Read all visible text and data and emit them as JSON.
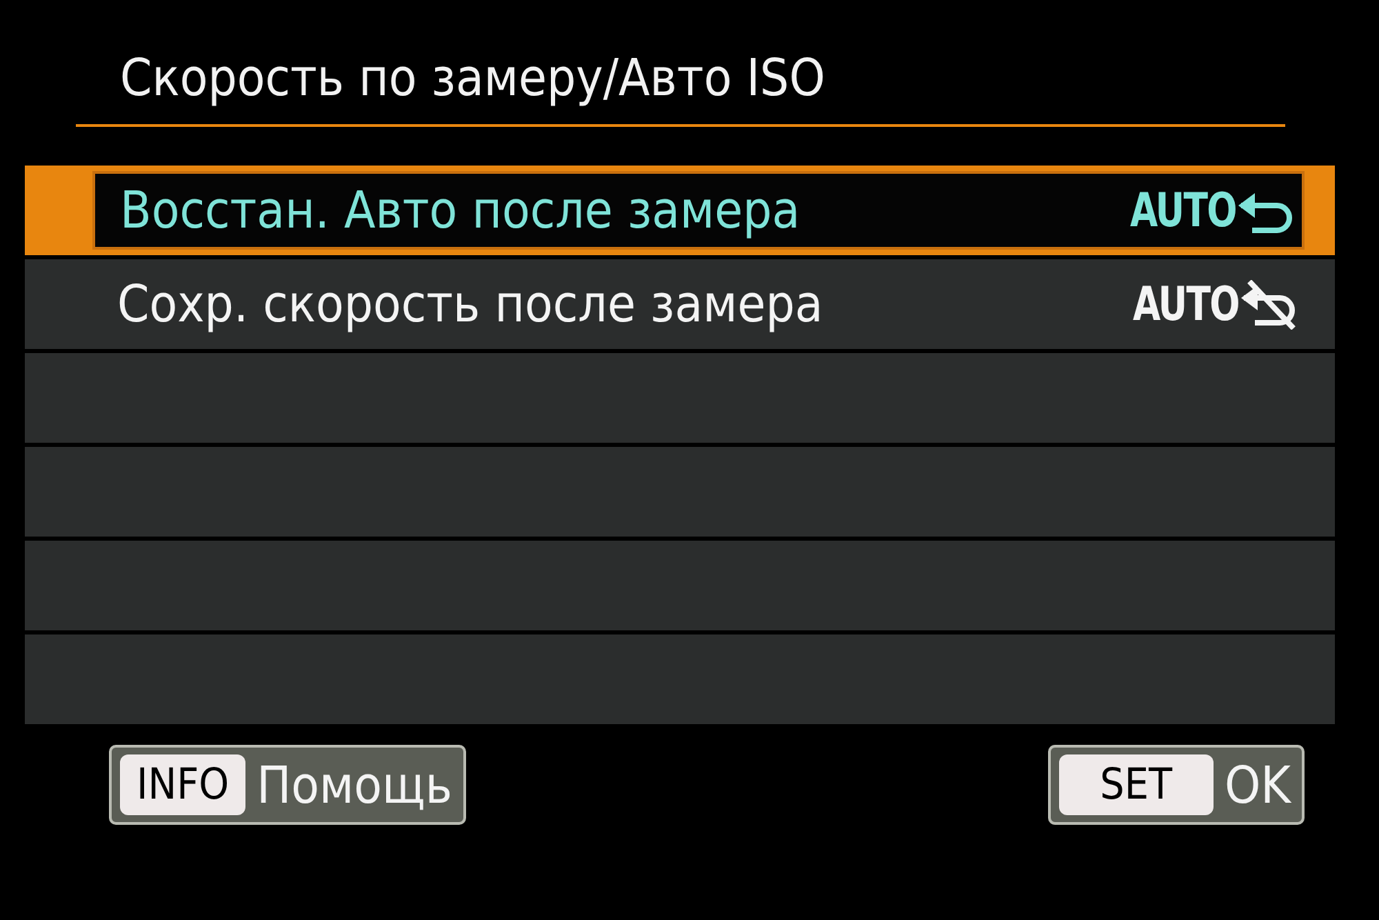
{
  "title": "Скорость по замеру/Авто ISO",
  "options": [
    {
      "kind": "restore",
      "label": "Восстан. Авто после замера",
      "value": "AUTO",
      "selected": true
    },
    {
      "kind": "keep",
      "label": "Сохр. скорость после замера",
      "value": "AUTO",
      "selected": false
    },
    {
      "kind": "blank"
    },
    {
      "kind": "blank"
    },
    {
      "kind": "blank"
    },
    {
      "kind": "blank"
    }
  ],
  "footer": [
    {
      "key": "INFO",
      "label": "Помощь"
    },
    {
      "key": "SET",
      "label": "OK"
    }
  ]
}
